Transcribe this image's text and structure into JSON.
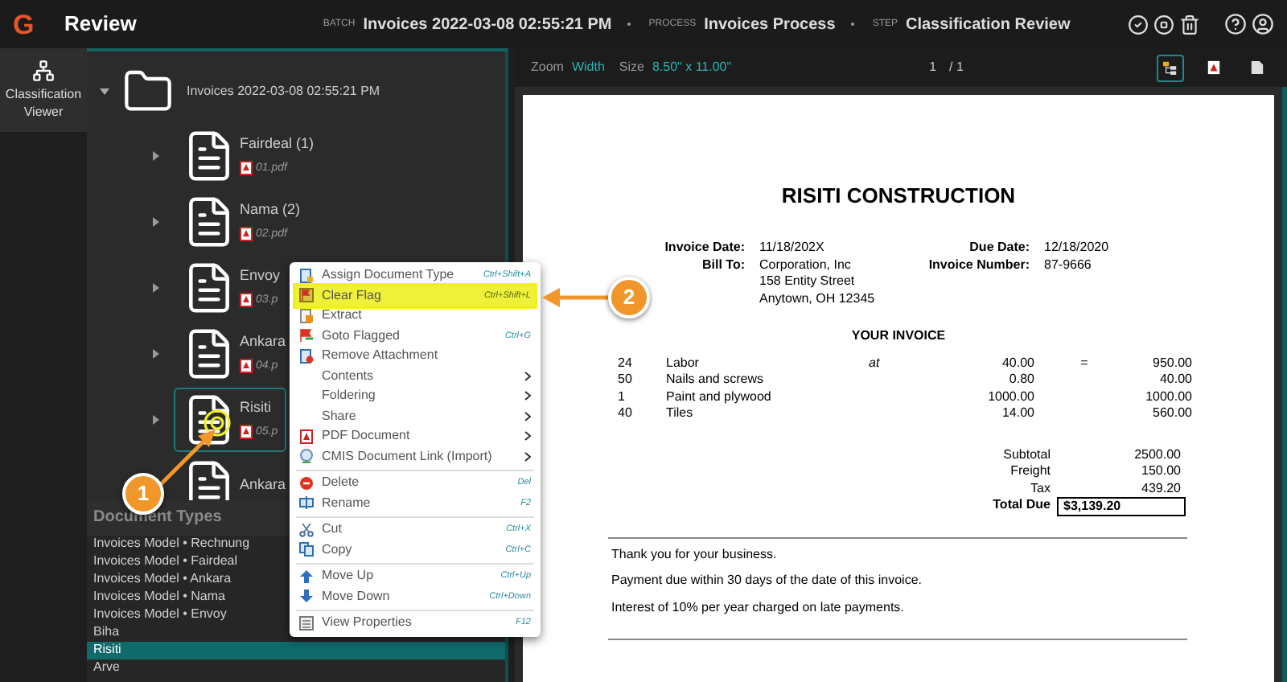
{
  "header": {
    "logo": "G",
    "title": "Review",
    "breadcrumbs": [
      {
        "label": "BATCH",
        "value": "Invoices 2022-03-08 02:55:21 PM"
      },
      {
        "label": "PROCESS",
        "value": "Invoices Process"
      },
      {
        "label": "STEP",
        "value": "Classification Review"
      }
    ]
  },
  "rail": {
    "items": [
      {
        "label": "Classification Viewer",
        "selected": true
      }
    ]
  },
  "tree": {
    "label": "Invoices 2022-03-08 02:55:21 PM",
    "expanded": true,
    "children": [
      {
        "label": "Fairdeal (1)",
        "file": "01.pdf",
        "expanded": false,
        "selected": false
      },
      {
        "label": "Nama (2)",
        "file": "02.pdf",
        "expanded": false,
        "selected": false
      },
      {
        "label": "Envoy",
        "file": "03.p",
        "expanded": false,
        "selected": false
      },
      {
        "label": "Ankara",
        "file": "04.p",
        "expanded": false,
        "selected": false
      },
      {
        "label": "Risiti",
        "file": "05.p",
        "expanded": false,
        "selected": true
      },
      {
        "label": "Ankara",
        "selected": false
      }
    ]
  },
  "document_types": {
    "title": "Document Types",
    "items": [
      {
        "label": "Invoices Model • Rechnung",
        "selected": false
      },
      {
        "label": "Invoices Model • Fairdeal",
        "selected": false
      },
      {
        "label": "Invoices Model • Ankara",
        "selected": false
      },
      {
        "label": "Invoices Model • Nama",
        "selected": false
      },
      {
        "label": "Invoices Model • Envoy",
        "selected": false
      },
      {
        "label": "Biha",
        "selected": false
      },
      {
        "label": "Risiti",
        "selected": true
      },
      {
        "label": "Arve",
        "selected": false
      }
    ]
  },
  "context_menu": {
    "items": [
      {
        "kind": "command",
        "label": "Assign Document Type",
        "shortcut": "Ctrl+Shift+A",
        "highlighted": false
      },
      {
        "kind": "command",
        "label": "Clear Flag",
        "shortcut": "Ctrl+Shift+L",
        "highlighted": true
      },
      {
        "kind": "command",
        "label": "Extract",
        "highlighted": false
      },
      {
        "kind": "command",
        "label": "Goto Flagged",
        "shortcut": "Ctrl+G",
        "highlighted": false
      },
      {
        "kind": "command",
        "label": "Remove Attachment",
        "highlighted": false
      },
      {
        "kind": "submenu",
        "label": "Contents",
        "highlighted": false
      },
      {
        "kind": "submenu",
        "label": "Foldering",
        "highlighted": false
      },
      {
        "kind": "submenu",
        "label": "Share",
        "highlighted": false
      },
      {
        "kind": "submenu",
        "label": "PDF Document",
        "highlighted": false
      },
      {
        "kind": "submenu",
        "label": "CMIS Document Link (Import)",
        "highlighted": false
      },
      {
        "kind": "separator"
      },
      {
        "kind": "command",
        "label": "Delete",
        "shortcut": "Del",
        "highlighted": false
      },
      {
        "kind": "command",
        "label": "Rename",
        "shortcut": "F2",
        "highlighted": false
      },
      {
        "kind": "separator"
      },
      {
        "kind": "command",
        "label": "Cut",
        "shortcut": "Ctrl+X",
        "highlighted": false
      },
      {
        "kind": "command",
        "label": "Copy",
        "shortcut": "Ctrl+C",
        "highlighted": false
      },
      {
        "kind": "separator"
      },
      {
        "kind": "command",
        "label": "Move Up",
        "shortcut": "Ctrl+Up",
        "highlighted": false
      },
      {
        "kind": "command",
        "label": "Move Down",
        "shortcut": "Ctrl+Down",
        "highlighted": false
      },
      {
        "kind": "separator"
      },
      {
        "kind": "command",
        "label": "View Properties",
        "shortcut": "F12",
        "highlighted": false
      }
    ]
  },
  "callouts": [
    {
      "number": "1"
    },
    {
      "number": "2"
    }
  ],
  "viewer": {
    "zoom_label": "Zoom",
    "zoom_value": "Width",
    "size_label": "Size",
    "size_value": "8.50\" x 11.00\"",
    "page": "1",
    "page_total": "/ 1",
    "tools": [
      {
        "selected": true
      },
      {
        "selected": false
      },
      {
        "selected": false
      }
    ]
  },
  "document": {
    "company": "RISITI CONSTRUCTION",
    "fields_left": [
      {
        "label": "Invoice Date:",
        "lines": [
          "11/18/202X"
        ]
      },
      {
        "label": "Bill To:",
        "lines": [
          "Corporation, Inc",
          "158 Entity Street",
          "Anytown, OH 12345"
        ]
      }
    ],
    "fields_right": [
      {
        "label": "Due Date:",
        "lines": [
          "12/18/2020"
        ]
      },
      {
        "label": "Invoice Number:",
        "lines": [
          "87-9666"
        ]
      }
    ],
    "section_title": "YOUR INVOICE",
    "line_items": [
      {
        "qty": "24",
        "description": "Labor",
        "at": "at",
        "price": "40.00",
        "equals": "=",
        "amount": "950.00"
      },
      {
        "qty": "50",
        "description": "Nails and screws",
        "price": "0.80",
        "amount": "40.00"
      },
      {
        "qty": "1",
        "description": "Paint and plywood",
        "price": "1000.00",
        "amount": "1000.00"
      },
      {
        "qty": "40",
        "description": "Tiles",
        "price": "14.00",
        "amount": "560.00"
      }
    ],
    "totals": [
      {
        "label": "Subtotal",
        "value": "2500.00",
        "kind": "plain"
      },
      {
        "label": "Freight",
        "value": "150.00",
        "kind": "plain"
      },
      {
        "label": "Tax",
        "value": "439.20",
        "kind": "plain"
      },
      {
        "label": "Total Due",
        "value": "$3,139.20",
        "kind": "total"
      }
    ],
    "notes": [
      "Thank you for your business.",
      "Payment due within 30 days of the date of this invoice.",
      "Interest of 10% per year charged on late payments."
    ]
  }
}
